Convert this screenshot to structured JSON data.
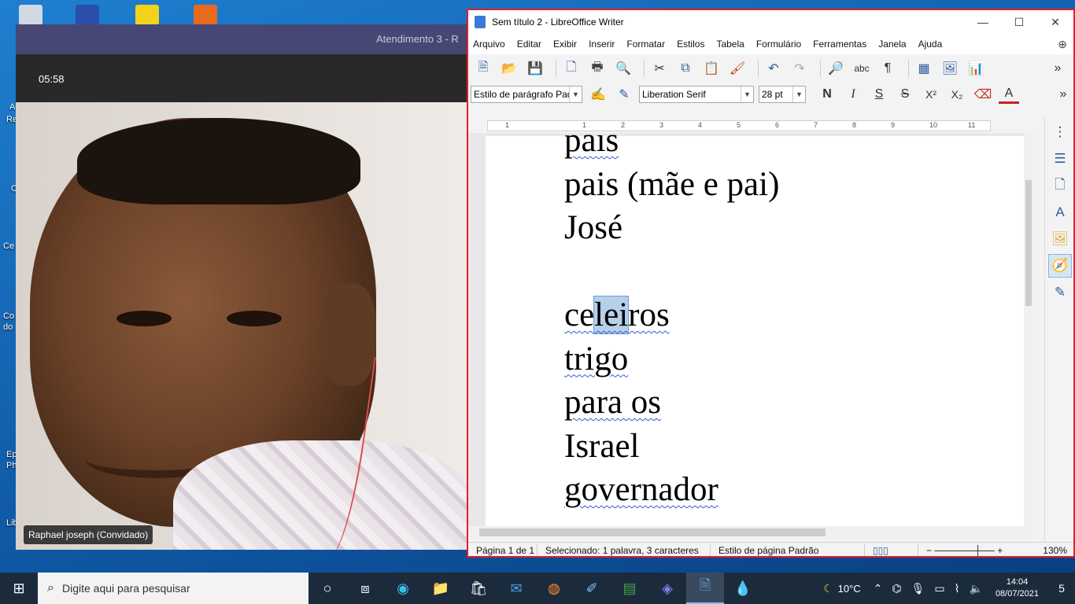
{
  "desktop": {
    "edge_labels": [
      "A",
      "Re",
      "C",
      "Ce",
      "Co",
      "do",
      "Ep",
      "Ph",
      "Lib"
    ]
  },
  "meeting": {
    "title": "Atendimento 3 - R",
    "timer": "05:58",
    "participant": "Raphael joseph (Convidado)"
  },
  "writer": {
    "title": "Sem título 2 - LibreOffice Writer",
    "window_controls": {
      "minimize": "—",
      "maximize": "☐",
      "close": "✕"
    },
    "menu": [
      "Arquivo",
      "Editar",
      "Exibir",
      "Inserir",
      "Formatar",
      "Estilos",
      "Tabela",
      "Formulário",
      "Ferramentas",
      "Janela",
      "Ajuda"
    ],
    "format": {
      "paragraph_style": "Estilo de parágrafo Padrã",
      "font_name": "Liberation Serif",
      "font_size": "28 pt",
      "bold": "N",
      "italic": "I",
      "underline": "S",
      "strike": "S",
      "superscript": "X²",
      "subscript": "X₂",
      "font_color": "A"
    },
    "ruler_numbers": [
      "1",
      "1",
      "2",
      "3",
      "4",
      "5",
      "6",
      "7",
      "8",
      "9",
      "10",
      "11"
    ],
    "doc_lines": [
      {
        "text": "país",
        "spell": true
      },
      {
        "text": "pais (mãe e pai)",
        "spell": false
      },
      {
        "text": "José",
        "spell": false
      },
      {
        "text": "",
        "spell": false
      },
      {
        "pre": "ce",
        "selected": "lei",
        "post": "ros",
        "spell": true
      },
      {
        "text": "trigo",
        "spell": true
      },
      {
        "text": "para os",
        "spell": true
      },
      {
        "text": "Israel",
        "spell": false
      },
      {
        "text": "governador",
        "spell": true
      }
    ],
    "status": {
      "page": "Página 1 de 1",
      "selection": "Selecionado: 1 palavra, 3 caracteres",
      "page_style": "Estilo de página Padrão",
      "zoom": "130%"
    }
  },
  "taskbar": {
    "search_placeholder": "Digite aqui para pesquisar",
    "weather": "10°C",
    "time": "14:04",
    "date": "08/07/2021",
    "notifications": "5"
  }
}
